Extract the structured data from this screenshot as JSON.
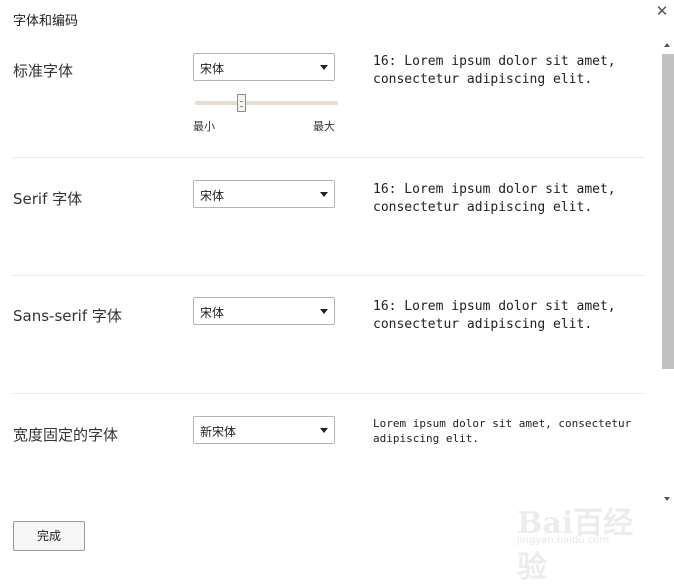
{
  "dialog": {
    "title": "字体和编码"
  },
  "rows": [
    {
      "label": "标准字体",
      "font": "宋体",
      "preview": "16: Lorem ipsum dolor sit amet, consectetur adipiscing elit.",
      "size_slider": {
        "value": 0.31,
        "min_label": "最小",
        "max_label": "最大"
      }
    },
    {
      "label": "Serif 字体",
      "font": "宋体",
      "preview": "16: Lorem ipsum dolor sit amet, consectetur adipiscing elit."
    },
    {
      "label": "Sans-serif 字体",
      "font": "宋体",
      "preview": "16: Lorem ipsum dolor sit amet, consectetur adipiscing elit."
    },
    {
      "label": "宽度固定的字体",
      "font": "新宋体",
      "preview": "Lorem ipsum dolor sit amet, consectetur adipiscing elit."
    }
  ],
  "footer": {
    "done_label": "完成"
  },
  "watermark": {
    "brand": "Bai百经验",
    "url": "jingyan.baidu.com"
  },
  "icons": {
    "close": "close-icon",
    "dropdown": "chevron-down-icon"
  }
}
